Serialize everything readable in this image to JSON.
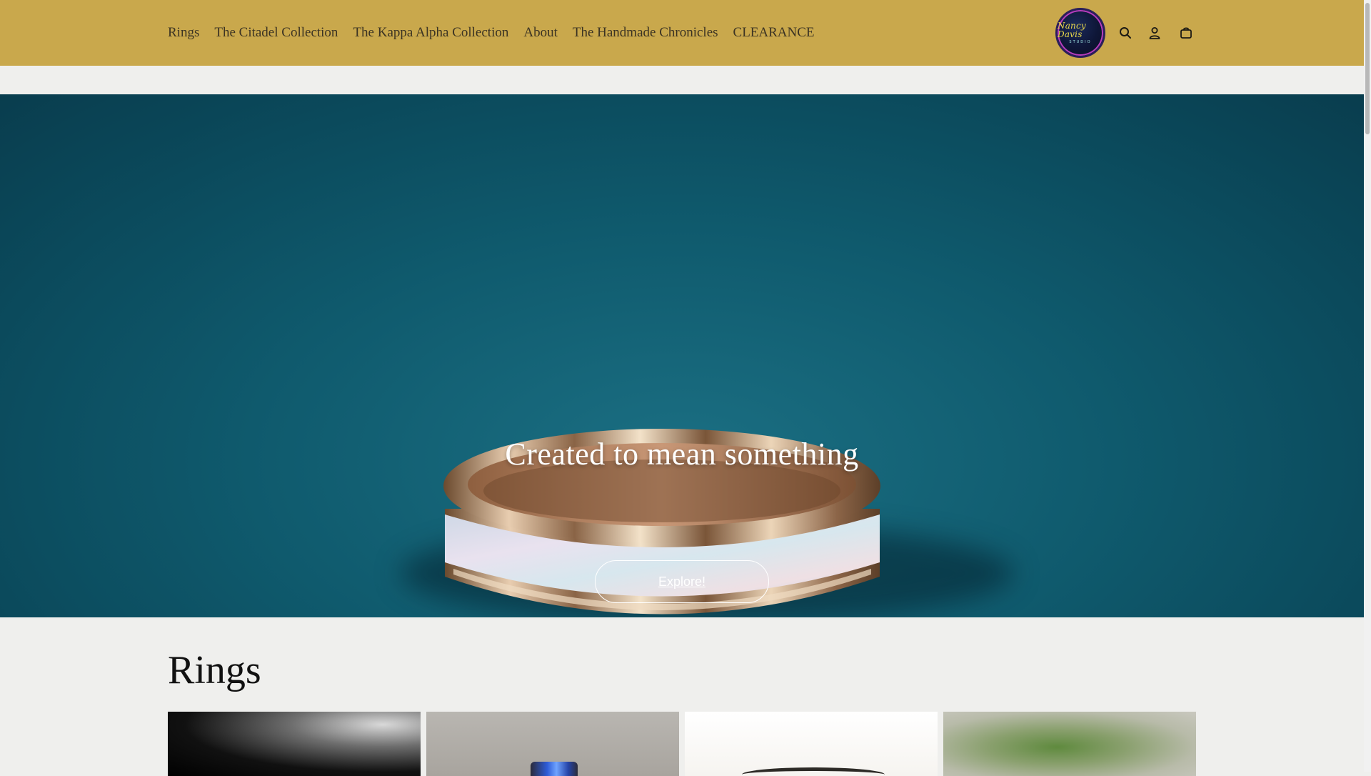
{
  "nav": {
    "items": [
      {
        "label": "Rings"
      },
      {
        "label": "The Citadel Collection"
      },
      {
        "label": "The Kappa Alpha Collection"
      },
      {
        "label": "About"
      },
      {
        "label": "The Handmade Chronicles"
      },
      {
        "label": "CLEARANCE"
      }
    ]
  },
  "logo": {
    "script": "Nancy Davis",
    "subtitle": "STUDIO"
  },
  "header_icons": [
    "search-icon",
    "account-icon",
    "cart-icon"
  ],
  "hero": {
    "title": "Created to mean something",
    "button_label": "Explore!"
  },
  "collection": {
    "title": "Rings",
    "cards": [
      {
        "name": "ring-product-1"
      },
      {
        "name": "ring-product-2"
      },
      {
        "name": "ring-product-3"
      },
      {
        "name": "ring-product-4"
      }
    ]
  },
  "colors": {
    "header_bg": "#c9a84c",
    "page_bg": "#efefed",
    "hero_bg": "#0f5a6d"
  }
}
